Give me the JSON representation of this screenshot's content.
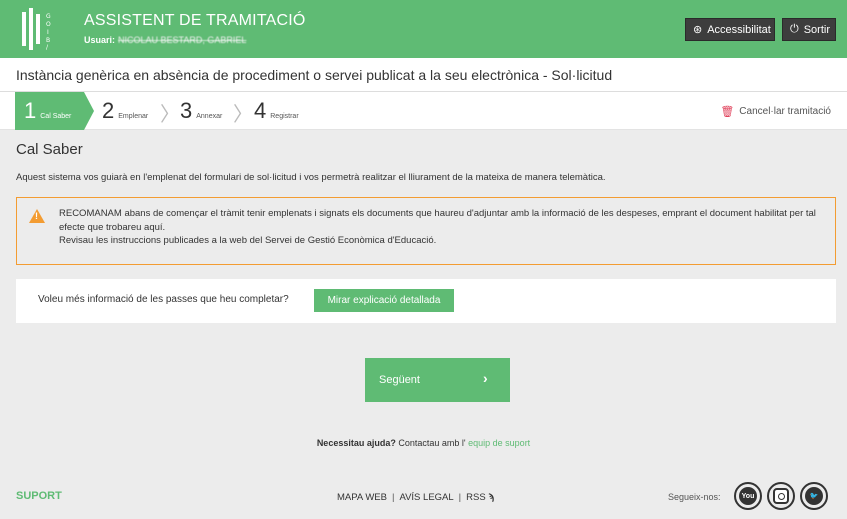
{
  "header": {
    "title": "ASSISTENT DE TRAMITACIÓ",
    "user_label": "Usuari:",
    "user_name": "NICOLAU BESTARD, GABRIEL",
    "logo_text": "G O I B /",
    "accessibility_label": "Accessibilitat",
    "exit_label": "Sortir",
    "color": "#5fbb74"
  },
  "procedure_title": "Instància genèrica en absència de procediment o servei publicat a la seu electrònica - Sol·licitud",
  "steps": [
    {
      "num": "1",
      "label": "Cal Saber"
    },
    {
      "num": "2",
      "label": "Emplenar"
    },
    {
      "num": "3",
      "label": "Annexar"
    },
    {
      "num": "4",
      "label": "Registrar"
    }
  ],
  "cancel_label": "Cancel·lar tramitació",
  "main": {
    "section_title": "Cal Saber",
    "intro": "Aquest sistema vos guiarà en l'emplenat del formulari de sol·licitud i vos permetrà realitzar el lliurament de la mateixa de manera telemàtica.",
    "warning_line1": "RECOMANAM abans de començar el tràmit tenir emplenats i signats els documents que haureu d'adjuntar amb la informació de les despeses, emprant el document habilitat per tal efecte que trobareu aquí.",
    "warning_line2": "Revisau les instruccions publicades a la web del Servei de Gestió Econòmica d'Educació.",
    "info_question": "Voleu més informació de les passes que heu completar?",
    "detail_button": "Mirar explicació detallada",
    "next_button": "Següent",
    "help_bold": "Necessitau ajuda?",
    "help_text": "Contactau amb l'",
    "help_link": "equip de suport"
  },
  "footer": {
    "suport": "SUPORT",
    "links": [
      "MAPA WEB",
      "AVÍS LEGAL",
      "RSS"
    ],
    "follow_label": "Segueix-nos:",
    "social_icons": [
      "youtube-icon",
      "instagram-icon",
      "twitter-icon"
    ]
  }
}
